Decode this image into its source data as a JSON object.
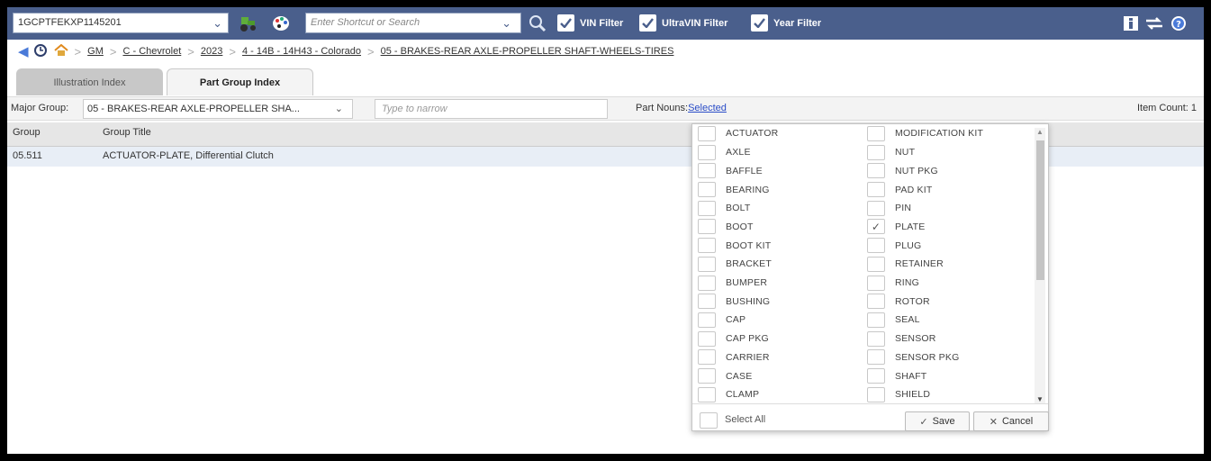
{
  "toolbar": {
    "vin": "1GCPTFEKXP1145201",
    "search_placeholder": "Enter Shortcut or Search",
    "filters": [
      {
        "label": "VIN Filter",
        "checked": true
      },
      {
        "label": "UltraVIN Filter",
        "checked": true
      },
      {
        "label": "Year Filter",
        "checked": true
      }
    ],
    "icons": [
      "tractor-icon",
      "palette-icon",
      "magnifier-icon",
      "info-icon",
      "exchange-icon",
      "help-icon"
    ]
  },
  "breadcrumb": [
    "GM",
    "C - Chevrolet",
    "2023",
    "4 - 14B - 14H43 - Colorado",
    "05 - BRAKES-REAR AXLE-PROPELLER SHAFT-WHEELS-TIRES"
  ],
  "tabs": [
    {
      "label": "Illustration Index",
      "active": false
    },
    {
      "label": "Part Group Index",
      "active": true
    }
  ],
  "filter_row": {
    "major_group_label": "Major Group:",
    "major_group_value": "05 - BRAKES-REAR AXLE-PROPELLER SHA...",
    "narrow_placeholder": "Type to narrow",
    "part_nouns_label": "Part Nouns:",
    "part_nouns_value": "Selected",
    "item_count": "Item Count: 1"
  },
  "table": {
    "headers": [
      "Group",
      "Group Title"
    ],
    "rows": [
      [
        "05.511",
        "ACTUATOR-PLATE, Differential Clutch"
      ]
    ]
  },
  "part_nouns_popup": {
    "left_column": [
      {
        "label": "ACTUATOR",
        "checked": false
      },
      {
        "label": "AXLE",
        "checked": false
      },
      {
        "label": "BAFFLE",
        "checked": false
      },
      {
        "label": "BEARING",
        "checked": false
      },
      {
        "label": "BOLT",
        "checked": false
      },
      {
        "label": "BOOT",
        "checked": false
      },
      {
        "label": "BOOT KIT",
        "checked": false
      },
      {
        "label": "BRACKET",
        "checked": false
      },
      {
        "label": "BUMPER",
        "checked": false
      },
      {
        "label": "BUSHING",
        "checked": false
      },
      {
        "label": "CAP",
        "checked": false
      },
      {
        "label": "CAP PKG",
        "checked": false
      },
      {
        "label": "CARRIER",
        "checked": false
      },
      {
        "label": "CASE",
        "checked": false
      },
      {
        "label": "CLAMP",
        "checked": false
      }
    ],
    "right_column": [
      {
        "label": "MODIFICATION KIT",
        "checked": false
      },
      {
        "label": "NUT",
        "checked": false
      },
      {
        "label": "NUT PKG",
        "checked": false
      },
      {
        "label": "PAD KIT",
        "checked": false
      },
      {
        "label": "PIN",
        "checked": false
      },
      {
        "label": "PLATE",
        "checked": true
      },
      {
        "label": "PLUG",
        "checked": false
      },
      {
        "label": "RETAINER",
        "checked": false
      },
      {
        "label": "RING",
        "checked": false
      },
      {
        "label": "ROTOR",
        "checked": false
      },
      {
        "label": "SEAL",
        "checked": false
      },
      {
        "label": "SENSOR",
        "checked": false
      },
      {
        "label": "SENSOR PKG",
        "checked": false
      },
      {
        "label": "SHAFT",
        "checked": false
      },
      {
        "label": "SHIELD",
        "checked": false
      }
    ],
    "select_all": "Select All",
    "save": "Save",
    "cancel": "Cancel"
  }
}
